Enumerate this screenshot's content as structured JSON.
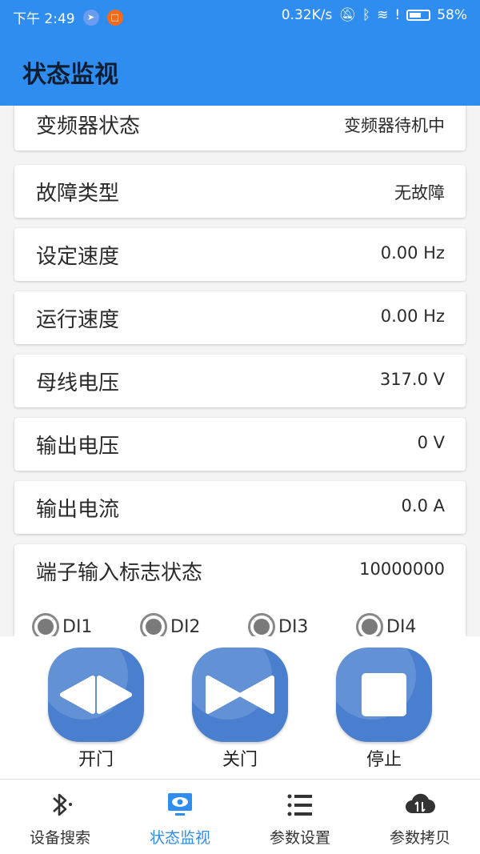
{
  "status_bar": {
    "time": "下午 2:49",
    "net_speed": "0.32K/s",
    "battery": "58%"
  },
  "app_bar": {
    "title": "状态监视"
  },
  "rows": [
    {
      "label": "变频器状态",
      "value": "变频器待机中"
    },
    {
      "label": "故障类型",
      "value": "无故障"
    },
    {
      "label": "设定速度",
      "value": "0.00 Hz"
    },
    {
      "label": "运行速度",
      "value": "0.00 Hz"
    },
    {
      "label": "母线电压",
      "value": "317.0 V"
    },
    {
      "label": "输出电压",
      "value": "0 V"
    },
    {
      "label": "输出电流",
      "value": "0.0 A"
    }
  ],
  "terminal": {
    "label": "端子输入标志状态",
    "value": "10000000",
    "inputs": [
      "DI1",
      "DI2",
      "DI3",
      "DI4"
    ]
  },
  "controls": {
    "open": "开门",
    "close": "关门",
    "stop": "停止"
  },
  "nav": [
    {
      "label": "设备搜索",
      "icon": "bluetooth-icon"
    },
    {
      "label": "状态监视",
      "icon": "monitor-eye-icon"
    },
    {
      "label": "参数设置",
      "icon": "list-icon"
    },
    {
      "label": "参数拷贝",
      "icon": "cloud-transfer-icon"
    }
  ],
  "colors": {
    "primary": "#2f8def",
    "button": "#4a7fcf"
  }
}
